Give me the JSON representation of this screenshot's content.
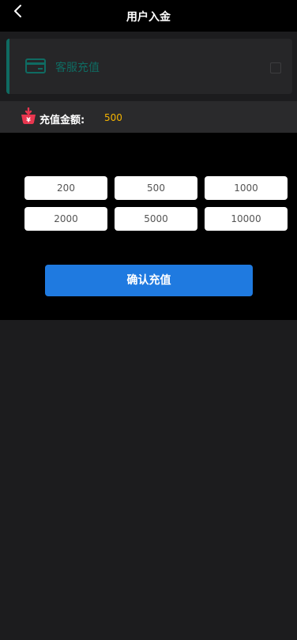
{
  "header": {
    "title": "用户入金",
    "back_icon": "chevron-left-icon"
  },
  "method": {
    "label": "客服充值",
    "icon": "credit-card-icon",
    "checked": false,
    "accent_color": "#0f6b62"
  },
  "amount": {
    "label": "充值金额:",
    "value": "500",
    "icon": "basket-yen-icon",
    "value_color": "#f5b400"
  },
  "options": [
    "200",
    "500",
    "1000",
    "2000",
    "5000",
    "10000"
  ],
  "confirm_button": {
    "label": "确认充值",
    "color": "#1f7ae0"
  }
}
